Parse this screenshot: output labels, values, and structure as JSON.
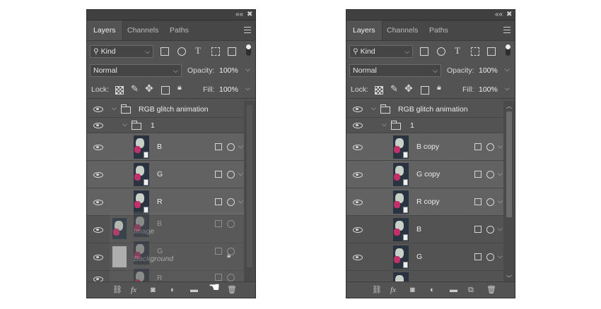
{
  "panels": [
    {
      "tabs": [
        "Layers",
        "Channels",
        "Paths"
      ],
      "filter": {
        "kind": "Kind"
      },
      "blend_mode": "Normal",
      "opacity_label": "Opacity:",
      "opacity_value": "100%",
      "lock_label": "Lock:",
      "fill_label": "Fill:",
      "fill_value": "100%",
      "group_name": "RGB glitch animation",
      "subgroup_name": "1",
      "layers": [
        "B",
        "G",
        "R"
      ],
      "dragged_layers": [
        "B",
        "G",
        "R"
      ],
      "behind_layers": [
        "Image",
        "Background"
      ]
    },
    {
      "tabs": [
        "Layers",
        "Channels",
        "Paths"
      ],
      "filter": {
        "kind": "Kind"
      },
      "blend_mode": "Normal",
      "opacity_label": "Opacity:",
      "opacity_value": "100%",
      "lock_label": "Lock:",
      "fill_label": "Fill:",
      "fill_value": "100%",
      "group_name": "RGB glitch animation",
      "subgroup_name": "1",
      "layers": [
        "B copy",
        "G copy",
        "R copy",
        "B",
        "G"
      ]
    }
  ],
  "icons": {
    "panel_controls": [
      "collapse-icon",
      "close-icon"
    ],
    "filters": [
      "image-filter-icon",
      "adjustment-filter-icon",
      "type-filter-icon",
      "shape-filter-icon",
      "smart-object-filter-icon"
    ],
    "lock": [
      "lock-pixels-icon",
      "lock-paint-icon",
      "lock-position-icon",
      "lock-artboard-icon",
      "lock-all-icon"
    ],
    "footer": [
      "link-icon",
      "fx-icon",
      "mask-icon",
      "adjustment-icon",
      "new-group-icon",
      "new-layer-icon",
      "trash-icon"
    ]
  },
  "colors": {
    "panel_bg": "#535353",
    "selected_row": "#626262"
  }
}
